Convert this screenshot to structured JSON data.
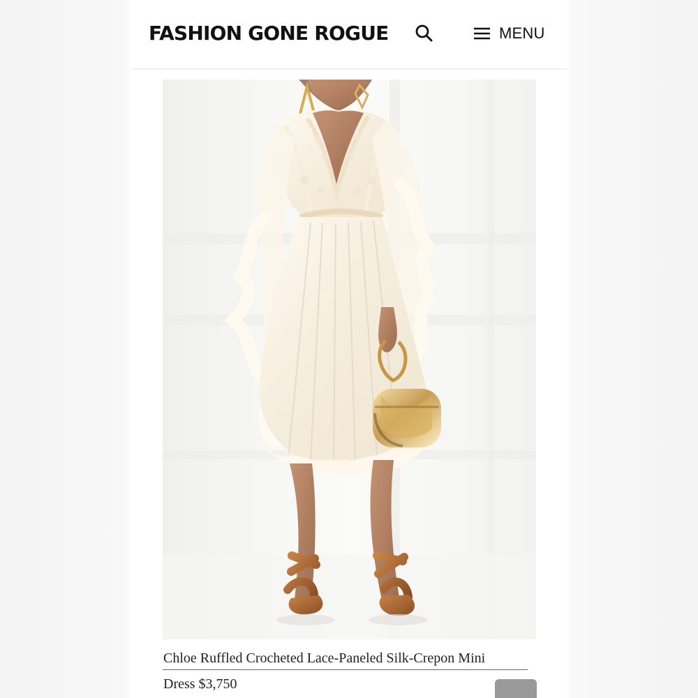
{
  "header": {
    "brand": "FASHION GONE ROGUE",
    "search_icon": "search-icon",
    "menu_icon": "hamburger-menu-icon",
    "menu_label": "MENU"
  },
  "product": {
    "image_alt": "Model wearing a white ruffled lace-paneled silk-crepon mini dress with a gold handbag and tan sandals",
    "title_line": "Chloe Ruffled Crocheted Lace-Paneled Silk-Crepon Mini",
    "price_line": "Dress $3,750"
  },
  "colors": {
    "accent_rule": "#c63b3b",
    "text": "#222222",
    "header_text": "#111111",
    "scroll_button": "#999999"
  }
}
